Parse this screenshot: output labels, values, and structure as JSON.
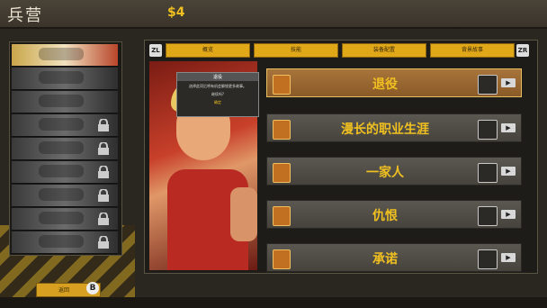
{
  "header": {
    "title": "兵营",
    "money": "$4"
  },
  "tabs": [
    {
      "label": "概览"
    },
    {
      "label": "技能"
    },
    {
      "label": "装备配置"
    },
    {
      "label": "背景故事"
    }
  ],
  "shoulder": {
    "left": "ZL",
    "right": "ZR"
  },
  "tooltip": {
    "title": "退役",
    "line1": "选择此项后将有机会解锁更多故事。",
    "line2": "继续吗?",
    "confirm": "确定"
  },
  "stories": [
    {
      "label": "退役"
    },
    {
      "label": "漫长的职业生涯"
    },
    {
      "label": "一家人"
    },
    {
      "label": "仇恨"
    },
    {
      "label": "承诺"
    }
  ],
  "footer": {
    "back_label": "返回",
    "back_key": "B"
  }
}
